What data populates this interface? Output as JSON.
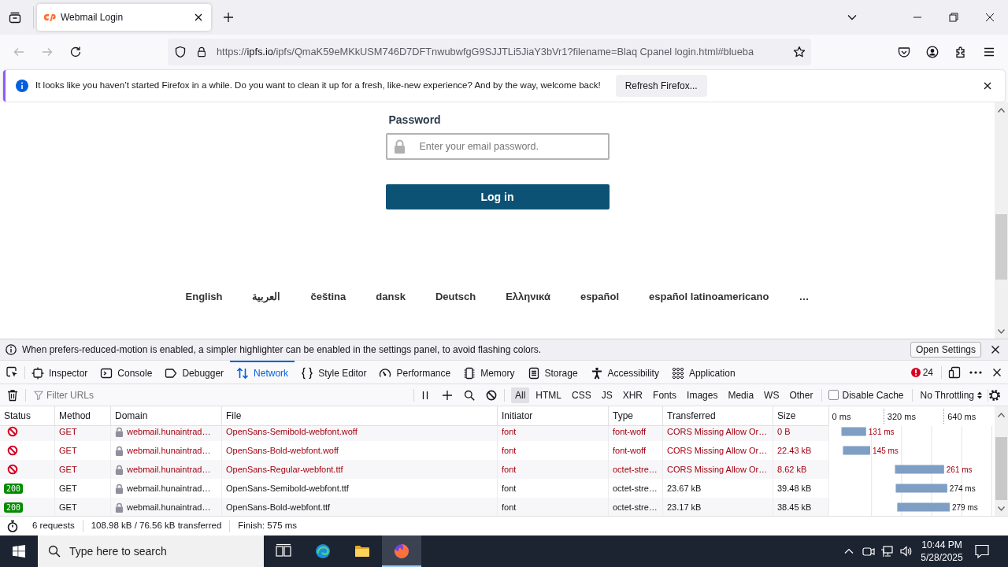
{
  "browser": {
    "tabs": [
      {
        "title": "Webmail Login",
        "selected": true
      }
    ],
    "address": {
      "scheme": "https://",
      "host": "ipfs.io",
      "path": "/ipfs/QmaK59eMKkUSM746D7DFTnwubwfgG9SJJTLi5JiaY3bVr1?filename=Blaq Cpanel login.html#blueba"
    }
  },
  "notification": {
    "message": "It looks like you haven’t started Firefox in a while. Do you want to clean it up for a fresh, like-new experience? And by the way, welcome back!",
    "button": "Refresh Firefox..."
  },
  "page": {
    "password_label": "Password",
    "password_placeholder": "Enter your email password.",
    "login_button": "Log in",
    "languages": [
      "English",
      "العربية",
      "čeština",
      "dansk",
      "Deutsch",
      "Ελληνικά",
      "español",
      "español latinoamericano"
    ],
    "more_languages": "…"
  },
  "devtools": {
    "notice": {
      "message": "When prefers-reduced-motion is enabled, a simpler highlighter can be enabled in the settings panel, to avoid flashing colors.",
      "button": "Open Settings"
    },
    "tabs": [
      {
        "kind": "inspector",
        "label": "Inspector",
        "selected": false
      },
      {
        "kind": "console",
        "label": "Console",
        "selected": false
      },
      {
        "kind": "debugger",
        "label": "Debugger",
        "selected": false
      },
      {
        "kind": "network",
        "label": "Network",
        "selected": true
      },
      {
        "kind": "style_editor",
        "label": "Style Editor",
        "selected": false
      },
      {
        "kind": "performance",
        "label": "Performance",
        "selected": false
      },
      {
        "kind": "memory",
        "label": "Memory",
        "selected": false
      },
      {
        "kind": "storage",
        "label": "Storage",
        "selected": false
      },
      {
        "kind": "accessibility",
        "label": "Accessibility",
        "selected": false
      },
      {
        "kind": "application",
        "label": "Application",
        "selected": false
      }
    ],
    "error_count": "24",
    "network": {
      "filter_placeholder": "Filter URLs",
      "type_filters": [
        {
          "label": "All",
          "selected": true
        },
        {
          "label": "HTML",
          "selected": false
        },
        {
          "label": "CSS",
          "selected": false
        },
        {
          "label": "JS",
          "selected": false
        },
        {
          "label": "XHR",
          "selected": false
        },
        {
          "label": "Fonts",
          "selected": false
        },
        {
          "label": "Images",
          "selected": false
        },
        {
          "label": "Media",
          "selected": false
        },
        {
          "label": "WS",
          "selected": false
        },
        {
          "label": "Other",
          "selected": false
        }
      ],
      "disable_cache": {
        "label": "Disable Cache",
        "checked": false
      },
      "throttling": "No Throttling",
      "columns": [
        "Status",
        "Method",
        "Domain",
        "File",
        "Initiator",
        "Type",
        "Transferred",
        "Size"
      ],
      "rows": [
        {
          "kind": "blocked",
          "error": true,
          "method": "GET",
          "domain": "webmail.hunaintrad…",
          "file": "OpenSans-Semibold-webfont.woff",
          "initiator": "font",
          "type": "font-woff",
          "transferred": "CORS Missing Allow Or…",
          "size": "0 B"
        },
        {
          "kind": "blocked",
          "error": true,
          "method": "GET",
          "domain": "webmail.hunaintrad…",
          "file": "OpenSans-Bold-webfont.woff",
          "initiator": "font",
          "type": "font-woff",
          "transferred": "CORS Missing Allow Or…",
          "size": "22.43 kB"
        },
        {
          "kind": "blocked",
          "error": true,
          "method": "GET",
          "domain": "webmail.hunaintrad…",
          "file": "OpenSans-Regular-webfont.ttf",
          "initiator": "font",
          "type": "octet-stre…",
          "transferred": "CORS Missing Allow Or…",
          "size": "8.62 kB"
        },
        {
          "kind": "response",
          "status": "200",
          "error": false,
          "method": "GET",
          "domain": "webmail.hunaintrad…",
          "file": "OpenSans-Semibold-webfont.ttf",
          "initiator": "font",
          "type": "octet-stre…",
          "transferred": "23.67 kB",
          "size": "39.48 kB"
        },
        {
          "kind": "response",
          "status": "200",
          "error": false,
          "method": "GET",
          "domain": "webmail.hunaintrad…",
          "file": "OpenSans-Bold-webfont.ttf",
          "initiator": "font",
          "type": "octet-stre…",
          "transferred": "23.17 kB",
          "size": "38.45 kB"
        }
      ],
      "chart_data": [
        {
          "type": "bar",
          "orientation": "horizontal",
          "categories": [
            null,
            null,
            null,
            null,
            null
          ],
          "base": [
            0,
            8,
            285,
            289,
            297
          ],
          "values": [
            131,
            145,
            261,
            274,
            279
          ],
          "value_labels": [
            "131 ms",
            "145 ms",
            "261 ms",
            "274 ms",
            "279 ms"
          ],
          "color": "#7f9ec4",
          "xlim": [
            -65,
            815
          ],
          "xticks": [
            {
              "value": 0,
              "label": "0 ms"
            },
            {
              "value": 320,
              "label": "320 ms"
            },
            {
              "value": 640,
              "label": "640 ms"
            }
          ],
          "grid": true
        }
      ],
      "summary": [
        "6 requests",
        "108.98 kB / 76.56 kB transferred",
        "Finish: 575 ms"
      ]
    }
  },
  "taskbar": {
    "search_placeholder": "Type here to search",
    "apps": [
      {
        "kind": "task_view",
        "selected": false
      },
      {
        "kind": "edge",
        "selected": false
      },
      {
        "kind": "files",
        "selected": false
      },
      {
        "kind": "firefox",
        "selected": true
      }
    ],
    "time": "10:44 PM",
    "date": "5/28/2025"
  }
}
